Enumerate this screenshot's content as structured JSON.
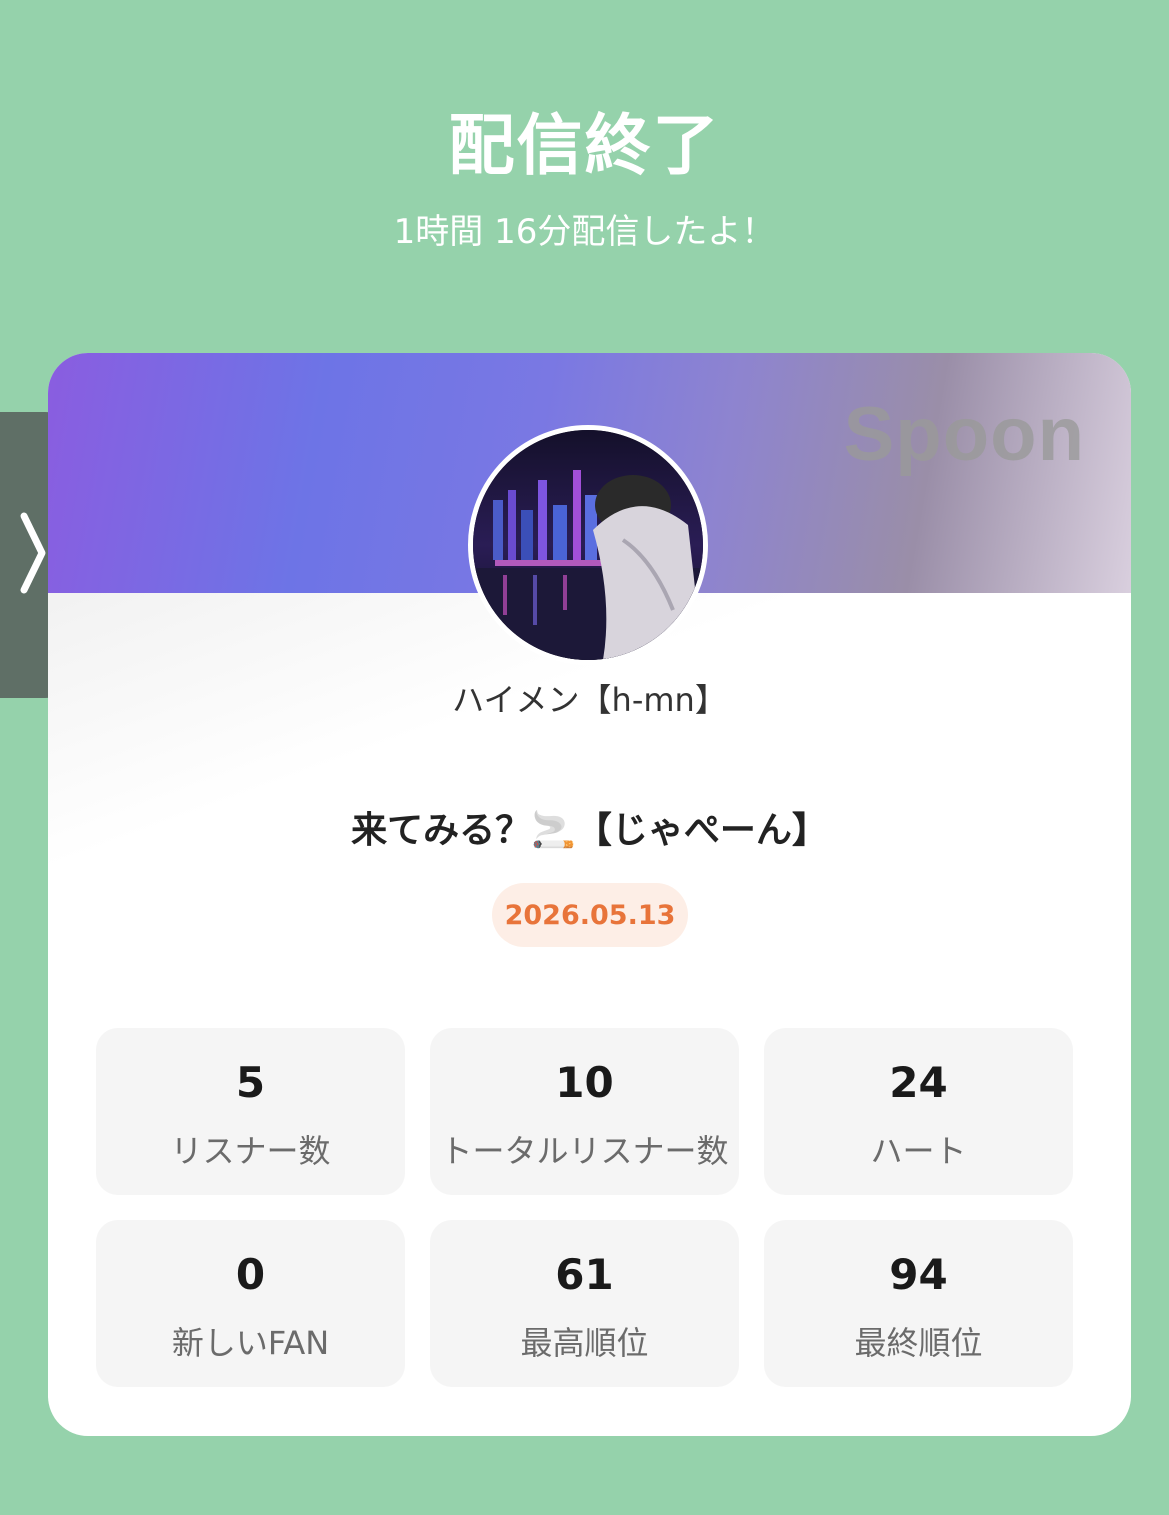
{
  "header": {
    "title": "配信終了",
    "subtitle": "1時間 16分配信したよ！"
  },
  "card": {
    "brand": "Spoon",
    "username": "ハイメン【h-mn】",
    "live_title": "来てみる？🚬【じゃぺーん】",
    "date": "2026.05.13"
  },
  "stats": [
    {
      "value": "5",
      "label": "リスナー数"
    },
    {
      "value": "10",
      "label": "トータルリスナー数"
    },
    {
      "value": "24",
      "label": "ハート"
    },
    {
      "value": "0",
      "label": "新しいFAN"
    },
    {
      "value": "61",
      "label": "最高順位"
    },
    {
      "value": "94",
      "label": "最終順位"
    }
  ],
  "colors": {
    "background": "#95d2ab",
    "date_badge_text": "#e8743a",
    "date_badge_bg": "#fdeee6"
  },
  "icons": {
    "side_handle": "chevron-right-icon"
  }
}
